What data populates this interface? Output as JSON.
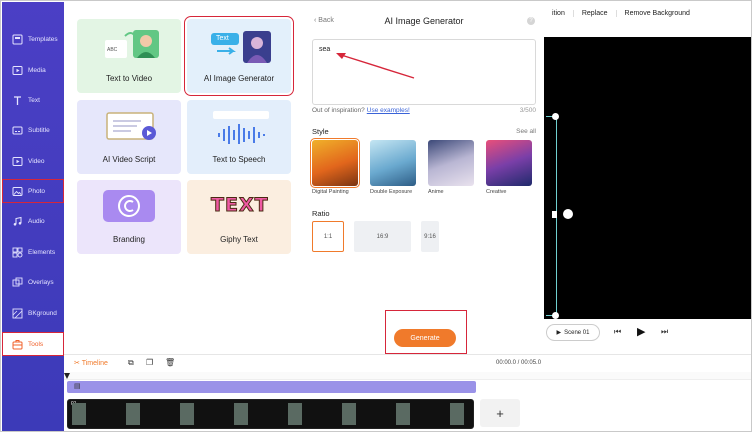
{
  "sidebar": {
    "items": [
      {
        "label": "Templates",
        "icon": "templates-icon"
      },
      {
        "label": "Media",
        "icon": "media-icon"
      },
      {
        "label": "Text",
        "icon": "text-icon"
      },
      {
        "label": "Subtitle",
        "icon": "subtitle-icon"
      },
      {
        "label": "Video",
        "icon": "video-icon"
      },
      {
        "label": "Photo",
        "icon": "photo-icon"
      },
      {
        "label": "Audio",
        "icon": "audio-icon"
      },
      {
        "label": "Elements",
        "icon": "elements-icon"
      },
      {
        "label": "Overlays",
        "icon": "overlays-icon"
      },
      {
        "label": "BKground",
        "icon": "background-icon"
      },
      {
        "label": "Tools",
        "icon": "tools-icon"
      }
    ]
  },
  "tools": {
    "tiles": [
      {
        "label": "Text to Video"
      },
      {
        "label": "AI Image Generator"
      },
      {
        "label": "AI Video Script"
      },
      {
        "label": "Text to Speech"
      },
      {
        "label": "Branding"
      },
      {
        "label": "Giphy Text"
      }
    ],
    "tile_art": {
      "text_badge": "Text",
      "abc_badge": "ABC",
      "giphy_art": "TEXT"
    }
  },
  "generator": {
    "back_label": "Back",
    "title": "AI Image Generator",
    "help": "?",
    "prompt_value": "sea",
    "inspiration_text": "Out of inspiration?",
    "inspiration_link": "Use examples!",
    "char_count": "3/500",
    "style_heading": "Style",
    "see_all": "See all",
    "styles": [
      {
        "label": "Digital Painting"
      },
      {
        "label": "Double Exposure"
      },
      {
        "label": "Anime"
      },
      {
        "label": "Creative"
      }
    ],
    "ratio_heading": "Ratio",
    "ratios": [
      {
        "label": "1:1"
      },
      {
        "label": "16:9"
      },
      {
        "label": "9:16"
      }
    ],
    "generate_label": "Generate"
  },
  "toolbar": {
    "items": [
      "ition",
      "Replace",
      "Remove Background"
    ]
  },
  "player": {
    "scene_label": "Scene  01"
  },
  "timeline": {
    "label": "Timeline",
    "time": "00:00.0 / 00:05.0",
    "clip_index": "01",
    "add_label": "+"
  },
  "colors": {
    "sidebar": "#4b3fc5",
    "accent": "#f07a2b",
    "highlight": "#d6263a",
    "link": "#3a63d8"
  }
}
